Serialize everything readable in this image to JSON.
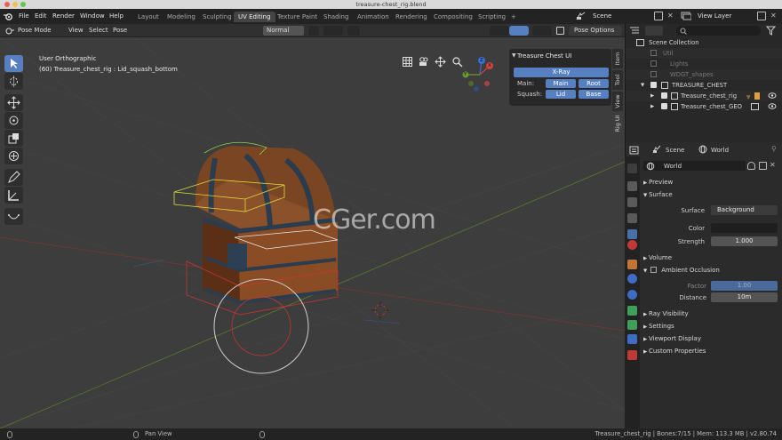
{
  "window": {
    "title": "treasure-chest_rig.blend"
  },
  "menubar": {
    "menus": [
      "File",
      "Edit",
      "Render",
      "Window",
      "Help"
    ],
    "workspaces": [
      "Layout",
      "Modeling",
      "Sculpting",
      "UV Editing",
      "Texture Paint",
      "Shading",
      "Animation",
      "Rendering",
      "Compositing",
      "Scripting"
    ],
    "active_workspace": "UV Editing",
    "add_tab": "+",
    "scene": "Scene",
    "view_layer": "View Layer"
  },
  "viewport_header": {
    "mode": "Pose Mode",
    "menus": [
      "View",
      "Select",
      "Pose"
    ],
    "orientation": "Normal",
    "pose_options": "Pose Options"
  },
  "viewport": {
    "view_name": "User Orthographic",
    "active_info": "(60) Treasure_chest_rig : Lid_squash_bottom",
    "watermark": "CGer.com",
    "gizmo_axes": {
      "x": "X",
      "y": "Y",
      "z": "Z"
    }
  },
  "npanel": {
    "title": "Treasure Chest UI",
    "xray_button": "X-Ray",
    "main_label": "Main:",
    "main_buttons": [
      "Main",
      "Root"
    ],
    "squash_label": "Squash:",
    "squash_buttons": [
      "Lid",
      "Base"
    ],
    "tabs": [
      "Item",
      "Tool",
      "View",
      "Rig UI"
    ]
  },
  "outliner": {
    "collection": "Scene Collection",
    "items": [
      {
        "name": "Util",
        "muted": true
      },
      {
        "name": "Lights",
        "muted": true
      },
      {
        "name": "WDGT_shapes",
        "muted": true
      },
      {
        "name": "TREASURE_CHEST",
        "muted": false
      },
      {
        "name": "Treasure_chest_rig",
        "muted": false
      },
      {
        "name": "Treasure_chest_GEO",
        "muted": false
      }
    ]
  },
  "properties": {
    "breadcrumb_scene": "Scene",
    "breadcrumb_world": "World",
    "world_name": "World",
    "sections": {
      "preview": "Preview",
      "surface": "Surface",
      "volume": "Volume",
      "ambient_occlusion": "Ambient Occlusion",
      "ray_visibility": "Ray Visibility",
      "settings": "Settings",
      "viewport_display": "Viewport Display",
      "custom_properties": "Custom Properties"
    },
    "surface_label": "Surface",
    "surface_value": "Background",
    "color_label": "Color",
    "strength_label": "Strength",
    "strength_value": "1.000",
    "factor_label": "Factor",
    "factor_value": "1.00",
    "distance_label": "Distance",
    "distance_value": "10m"
  },
  "statusbar": {
    "hint": "Pan View",
    "info": "Treasure_chest_rig | Bones:7/15 | Mem: 113.3 MB | v2.80.74"
  },
  "colors": {
    "accent": "#5680c2",
    "viewport_bg": "#3d3d3d",
    "panel_bg": "#2b2b2b",
    "header_bg": "#303030"
  }
}
